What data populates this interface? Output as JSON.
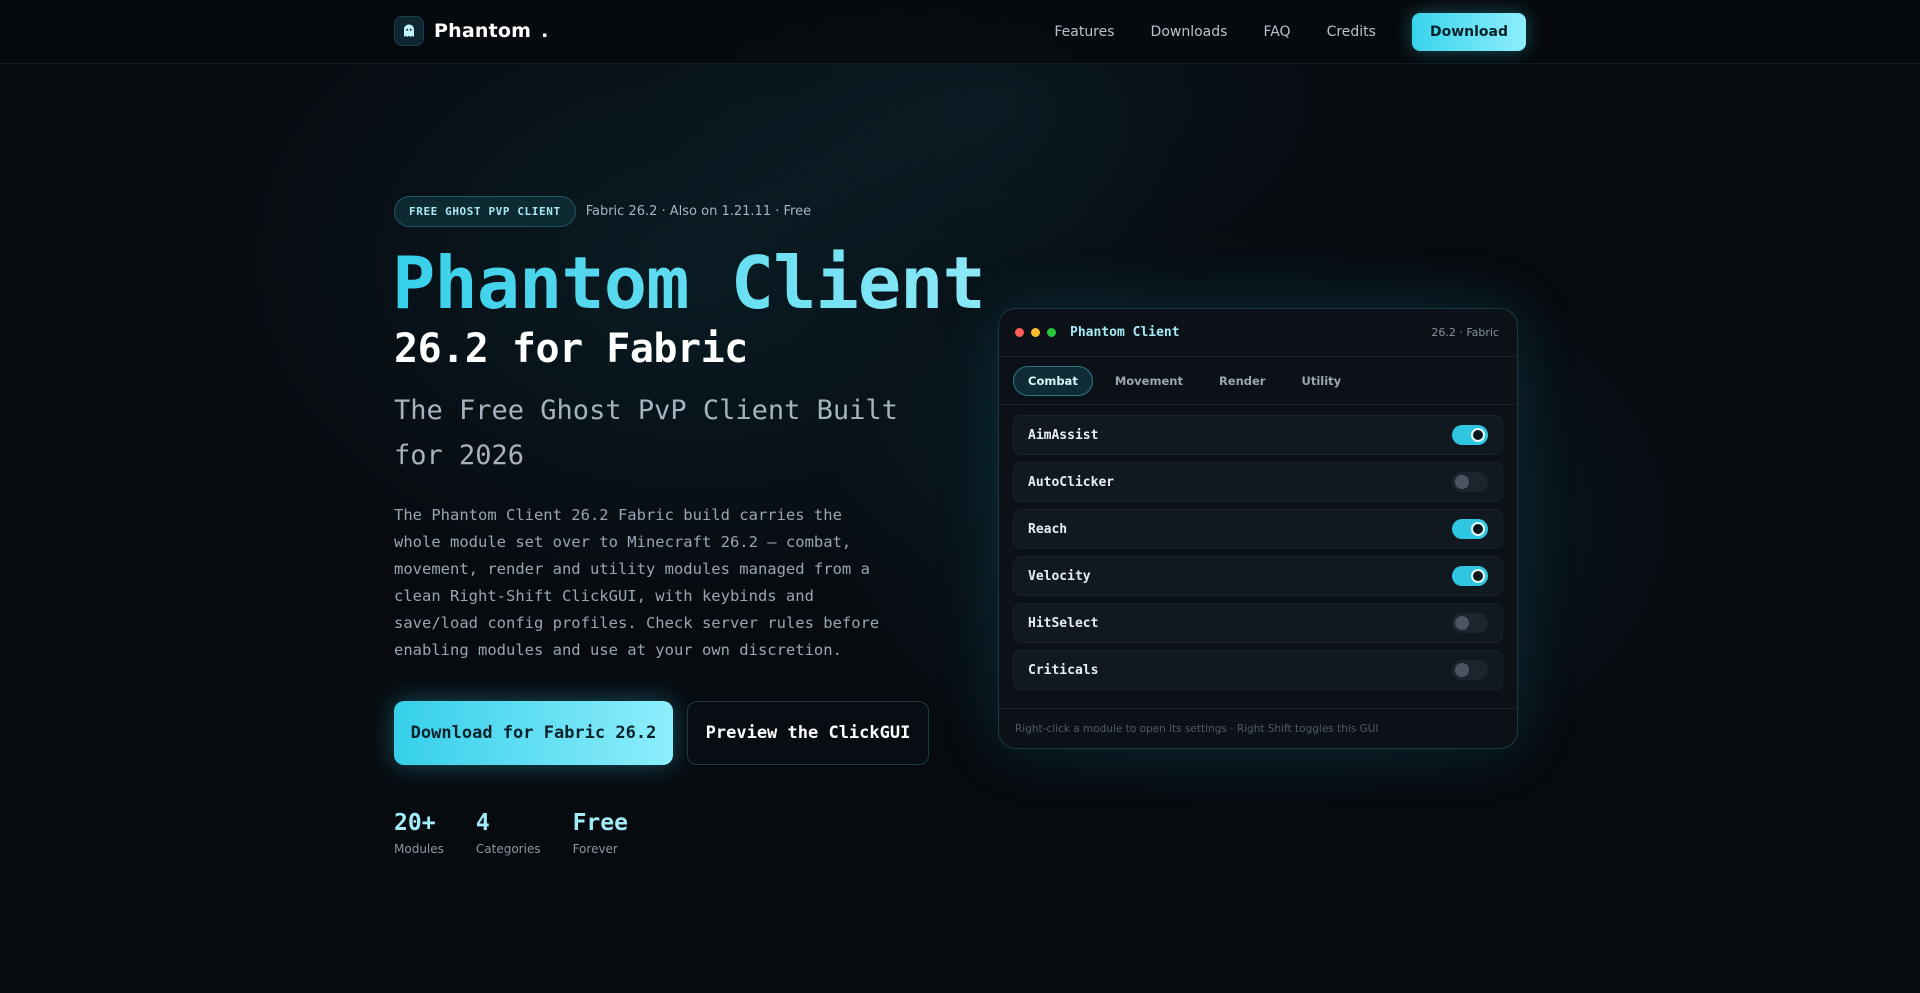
{
  "nav": {
    "brand": "Phantom",
    "brand_dot": ".",
    "links": [
      "Features",
      "Downloads",
      "FAQ",
      "Credits"
    ],
    "cta": "Download"
  },
  "hero": {
    "badge": "FREE GHOST PVP CLIENT",
    "meta": "Fabric 26.2 · Also on 1.21.11 · Free",
    "title": "Phantom Client",
    "subtitle": "26.2 for Fabric",
    "tagline": "The Free Ghost PvP Client Built for 2026",
    "description": "The Phantom Client 26.2 Fabric build carries the whole module set over to Minecraft 26.2 — combat, movement, render and utility modules managed from a clean Right-Shift ClickGUI, with keybinds and save/load config profiles. Check server rules before enabling modules and use at your own discretion.",
    "primary_button": "Download for Fabric 26.2",
    "secondary_button": "Preview the ClickGUI",
    "stats": [
      {
        "value": "20+",
        "label": "Modules"
      },
      {
        "value": "4",
        "label": "Categories"
      },
      {
        "value": "Free",
        "label": "Forever"
      }
    ]
  },
  "panel": {
    "title": "Phantom Client",
    "version": "26.2 · Fabric",
    "dot_colors": [
      "#ff5f57",
      "#febc2e",
      "#28c840"
    ],
    "tabs": [
      "Combat",
      "Movement",
      "Render",
      "Utility"
    ],
    "active_tab": "Combat",
    "modules": [
      {
        "name": "AimAssist",
        "enabled": true
      },
      {
        "name": "AutoClicker",
        "enabled": false
      },
      {
        "name": "Reach",
        "enabled": true
      },
      {
        "name": "Velocity",
        "enabled": true
      },
      {
        "name": "HitSelect",
        "enabled": false
      },
      {
        "name": "Criticals",
        "enabled": false
      }
    ],
    "footer": "Right-click a module to open its settings · Right Shift toggles this GUI"
  },
  "colors": {
    "accent": "#36cfea",
    "accent_light": "#8eeefc",
    "background": "#070b10"
  },
  "icons": {
    "brand_logo": "ghost-icon"
  }
}
